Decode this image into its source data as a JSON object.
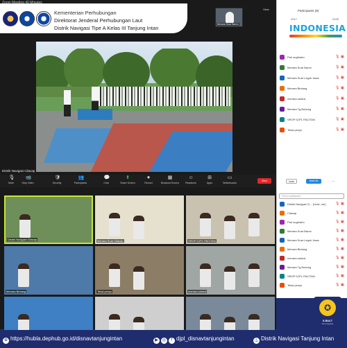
{
  "zoom": {
    "title": "Zoom Meeting 40 Minutes",
    "pin_bar": "This is to pin screen to see more at a glance",
    "view_label": "View",
    "mini_tile_label": "Menara Suar Baron",
    "speaker_name": "Distrik Navigasi Cilacap",
    "end_label": "End"
  },
  "header": {
    "line1": "Kementerian Perhubungan",
    "line2": "Direktorat Jenderal Perhubungan Laut",
    "line3": "Distrik Navigasi Tipe A Kelas III Tanjung Intan"
  },
  "toolbar": {
    "items": [
      {
        "label": "Mute",
        "icon": "🎙"
      },
      {
        "label": "Stop Video",
        "icon": "📹"
      },
      {
        "label": "Security",
        "icon": "🛡"
      },
      {
        "label": "Participants",
        "icon": "👥"
      },
      {
        "label": "Chat",
        "icon": "💬"
      },
      {
        "label": "Share Screen",
        "icon": "⬆"
      },
      {
        "label": "Record",
        "icon": "⏺"
      },
      {
        "label": "Breakout Rooms",
        "icon": "▦"
      },
      {
        "label": "Reactions",
        "icon": "☺"
      },
      {
        "label": "Apps",
        "icon": "⊞"
      },
      {
        "label": "Whiteboards",
        "icon": "▭"
      }
    ]
  },
  "participants_top": {
    "title": "Participants (8)",
    "items": [
      {
        "name": "Pari sugiharto",
        "color": "#9c27b0"
      },
      {
        "name": "Menara Suar Baron",
        "color": "#2e7d32"
      },
      {
        "name": "Menara Suar Legok Jawa",
        "color": "#1565c0"
      },
      {
        "name": "Menara Bintang",
        "color": "#ef6c00"
      },
      {
        "name": "menara santuk",
        "color": "#c62828"
      },
      {
        "name": "Menara Tg.Bodong",
        "color": "#6a1b9a"
      },
      {
        "name": "SROP DJPL PACITAN",
        "color": "#00838f"
      },
      {
        "name": "Tekal penyu",
        "color": "#e65100"
      }
    ],
    "invite_label": "Invite",
    "mute_all_label": "Mute All",
    "more_label": "..."
  },
  "indonesia_logo": {
    "year_left": "2017",
    "year_right": "2025",
    "text": "INDONESIA"
  },
  "participants_bottom": {
    "search_placeholder": "Find a participant",
    "items": [
      {
        "name": "Distrik Navigasi Ci... (Host, me)",
        "color": "#1565c0"
      },
      {
        "name": "Cilacap",
        "color": "#ef6c00"
      },
      {
        "name": "Pari sugiharto",
        "color": "#9c27b0"
      },
      {
        "name": "Menara Suar Baron",
        "color": "#2e7d32"
      },
      {
        "name": "Menara Suar Legok Jawa",
        "color": "#1565c0"
      },
      {
        "name": "Menara Bintang",
        "color": "#ef6c00"
      },
      {
        "name": "menara santuk",
        "color": "#c62828"
      },
      {
        "name": "Menara Tg.Bodong",
        "color": "#6a1b9a"
      },
      {
        "name": "SROP DJPL PACITAN",
        "color": "#00838f"
      },
      {
        "name": "Tekal penyu",
        "color": "#e65100"
      }
    ]
  },
  "gallery": {
    "tiles": [
      {
        "label": "Distrik Navigasi Cilacap",
        "bg": "#6f8f5a"
      },
      {
        "label": "Menara Suar Cilacap",
        "bg": "#e6e0cf"
      },
      {
        "label": "SROP DJPL PACITAN",
        "bg": "#c9c2b0"
      },
      {
        "label": "Menara Bintang",
        "bg": "#4d7aa8"
      },
      {
        "label": "Tekal penyu",
        "bg": "#8c7d66"
      },
      {
        "label": "menara santuk",
        "bg": "#9fa6a3"
      },
      {
        "label": "Menara Suar Legok Jawa",
        "bg": "#3f7fc4"
      },
      {
        "label": "Menara Tg.Bodong",
        "bg": "#cfcfcf"
      },
      {
        "label": "Pari sugiharto",
        "bg": "#7a8a9a"
      }
    ]
  },
  "sbult": {
    "text": "S.BULT",
    "sub": "Zona Integritas"
  },
  "footer": {
    "link": "https://hubla.dephub.go.id/disnavtanjungintan",
    "social": "djpl_disnavtanjungintan",
    "brand": "Distrik Navigasi Tanjung Intan"
  }
}
